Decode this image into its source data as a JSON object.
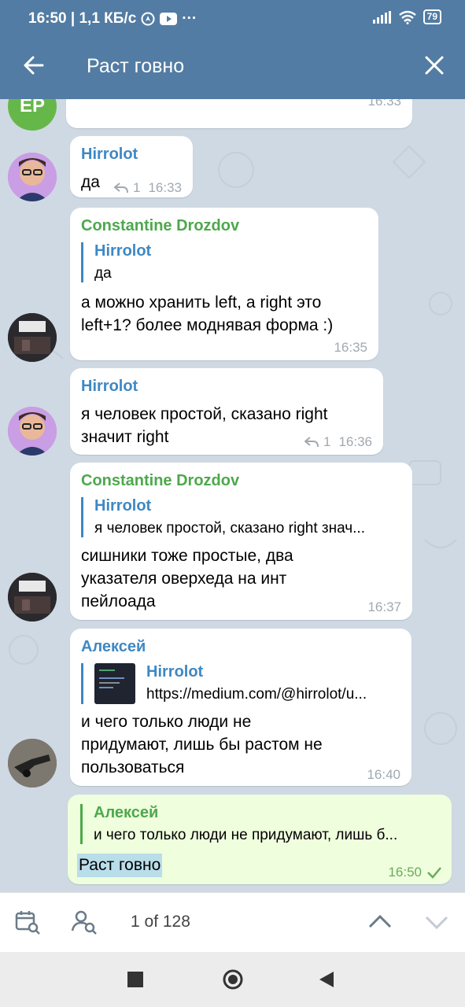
{
  "status_bar": {
    "left_text": "16:50 | 1,1 КБ/с",
    "battery": "79",
    "icons": [
      "navigator-icon",
      "youtube-icon",
      "more-icon",
      "signal-icon",
      "wifi-icon",
      "battery-icon"
    ]
  },
  "header": {
    "title": "Раст говно"
  },
  "messages": [
    {
      "id": "m0",
      "avatar": "EP",
      "avatar_color": "#66b74a",
      "time": "16:33"
    },
    {
      "id": "m1",
      "sender": "Hirrolot",
      "text": "да",
      "replies": "1",
      "time": "16:33"
    },
    {
      "id": "m2",
      "sender": "Constantine Drozdov",
      "quote_name": "Hirrolot",
      "quote_text": "да",
      "text": "а можно хранить left, а right это\nleft+1? более моднявая форма :)",
      "time": "16:35"
    },
    {
      "id": "m3",
      "sender": "Hirrolot",
      "text": "я человек простой, сказано right\nзначит right",
      "replies": "1",
      "time": "16:36"
    },
    {
      "id": "m4",
      "sender": "Constantine Drozdov",
      "quote_name": "Hirrolot",
      "quote_text": "я человек простой, сказано right знач...",
      "text": "сишники тоже простые, два\nуказателя оверхеда на инт\nпейлоада",
      "time": "16:37"
    },
    {
      "id": "m5",
      "sender": "Алексей",
      "quote_name": "Hirrolot",
      "quote_text": "https://medium.com/@hirrolot/u...",
      "text": "и чего только люди не\nпридумают, лишь бы растом не\nпользоваться",
      "time": "16:40"
    },
    {
      "id": "m6",
      "quote_name": "Алексей",
      "quote_text": "и чего только люди не придумают, лишь б...",
      "text": "Раст говно",
      "time": "16:50"
    }
  ],
  "search_bar": {
    "counter": "1 of 128"
  },
  "colors": {
    "header": "#527ca3",
    "chat_bg": "#cfd9e3",
    "own_bubble": "#effedd",
    "name_blue": "#3e88c4",
    "name_green": "#4da84c",
    "highlight": "#b9dde9"
  }
}
